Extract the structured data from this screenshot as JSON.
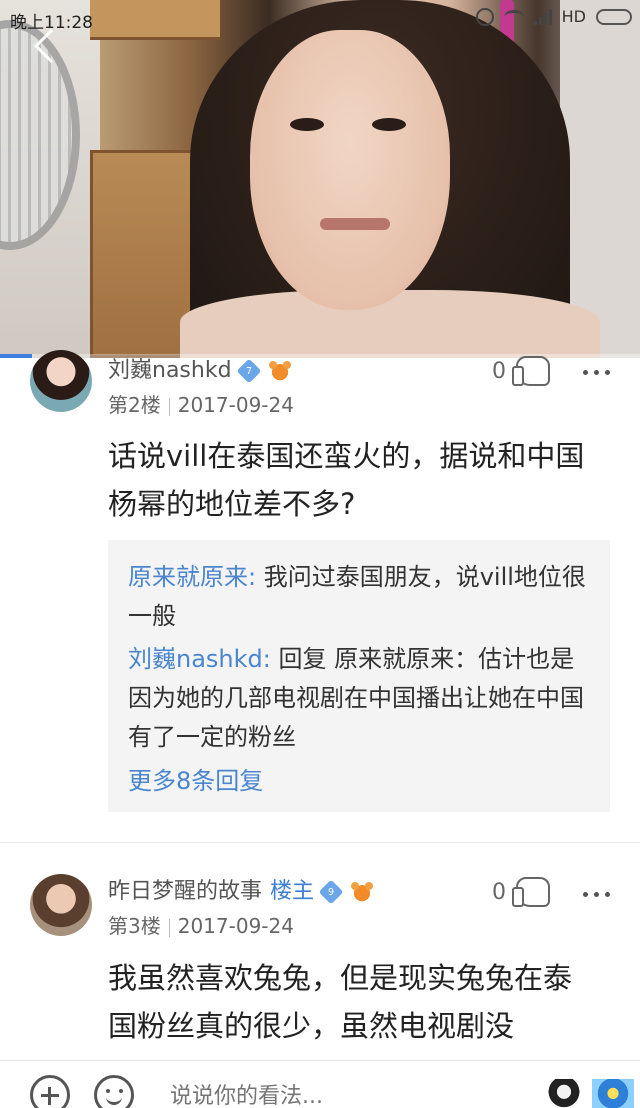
{
  "status_bar": {
    "time": "晚上11:28",
    "network": "HD"
  },
  "video": {
    "progress_fraction": 0.05
  },
  "comments": [
    {
      "username": "刘巍nashkd",
      "level": "7",
      "floor": "第2楼",
      "date": "2017-09-24",
      "likes": "0",
      "text": "话说vill在泰国还蛮火的，据说和中国杨幂的地位差不多?",
      "replies": [
        {
          "name": "原来就原来:",
          "text": " 我问过泰国朋友，说vill地位很一般"
        },
        {
          "name": "刘巍nashkd:",
          "text": " 回复 原来就原来：估计也是因为她的几部电视剧在中国播出让她在中国有了一定的粉丝"
        }
      ],
      "more_replies": "更多8条回复"
    },
    {
      "username": "昨日梦醒的故事",
      "tag": "楼主",
      "level": "9",
      "floor": "第3楼",
      "date": "2017-09-24",
      "likes": "0",
      "text": "我虽然喜欢兔兔，但是现实兔兔在泰国粉丝真的很少，虽然电视剧没"
    }
  ],
  "bottom_bar": {
    "input_placeholder": "说说你的看法..."
  },
  "icons": {
    "back": "back-arrow-icon",
    "add": "plus-circle-icon",
    "emoji": "emoji-icon",
    "like": "like-hand-icon",
    "more": "more-dots-icon"
  },
  "colors": {
    "link_blue": "#4a86cf",
    "reply_bg": "#f4f4f4",
    "badge_blue": "#6aa6e8",
    "badge_orange": "#f28c2b"
  }
}
